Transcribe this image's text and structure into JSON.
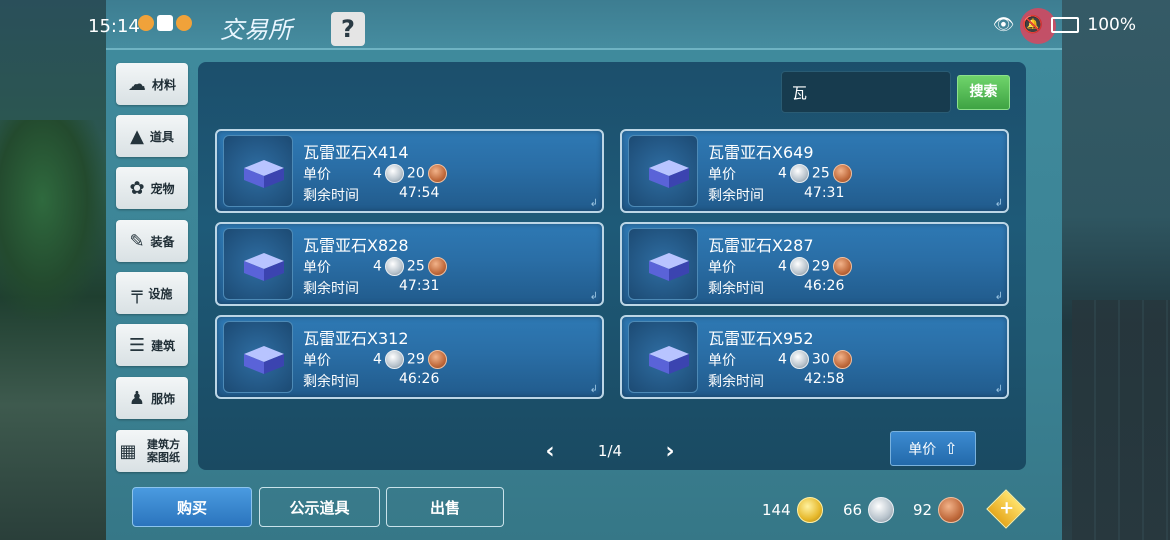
{
  "status_bar": {
    "time": "15:14",
    "battery_text": "100%"
  },
  "header": {
    "title": "交易所",
    "help_label": "?"
  },
  "sidebar": {
    "items": [
      {
        "label": "材料",
        "icon": "materials-icon"
      },
      {
        "label": "道具",
        "icon": "tools-icon"
      },
      {
        "label": "宠物",
        "icon": "pet-paw-icon"
      },
      {
        "label": "装备",
        "icon": "equipment-icon"
      },
      {
        "label": "设施",
        "icon": "facility-icon"
      },
      {
        "label": "建筑",
        "icon": "building-icon"
      },
      {
        "label": "服饰",
        "icon": "clothing-icon"
      },
      {
        "label": "建筑方案图纸",
        "icon": "blueprint-icon"
      }
    ]
  },
  "search": {
    "value": "瓦",
    "button_label": "搜索"
  },
  "listings": [
    {
      "name": "瓦雷亚石X414",
      "price_label": "单价",
      "silver": "4",
      "copper": "20",
      "time_label": "剩余时间",
      "time": "47:54"
    },
    {
      "name": "瓦雷亚石X649",
      "price_label": "单价",
      "silver": "4",
      "copper": "25",
      "time_label": "剩余时间",
      "time": "47:31"
    },
    {
      "name": "瓦雷亚石X828",
      "price_label": "单价",
      "silver": "4",
      "copper": "25",
      "time_label": "剩余时间",
      "time": "47:31"
    },
    {
      "name": "瓦雷亚石X287",
      "price_label": "单价",
      "silver": "4",
      "copper": "29",
      "time_label": "剩余时间",
      "time": "46:26"
    },
    {
      "name": "瓦雷亚石X312",
      "price_label": "单价",
      "silver": "4",
      "copper": "29",
      "time_label": "剩余时间",
      "time": "46:26"
    },
    {
      "name": "瓦雷亚石X952",
      "price_label": "单价",
      "silver": "4",
      "copper": "30",
      "time_label": "剩余时间",
      "time": "42:58"
    }
  ],
  "pagination": {
    "page": "1/4"
  },
  "sort": {
    "label": "单价"
  },
  "bottom": {
    "buy_label": "购买",
    "public_label": "公示道具",
    "sell_label": "出售"
  },
  "wallet": {
    "gold": "144",
    "silver": "66",
    "copper": "92",
    "add_label": "+"
  },
  "colors": {
    "card_bg": "#2a6ea6",
    "search_button": "#4fb84f",
    "buy_button": "#3a86cf"
  }
}
